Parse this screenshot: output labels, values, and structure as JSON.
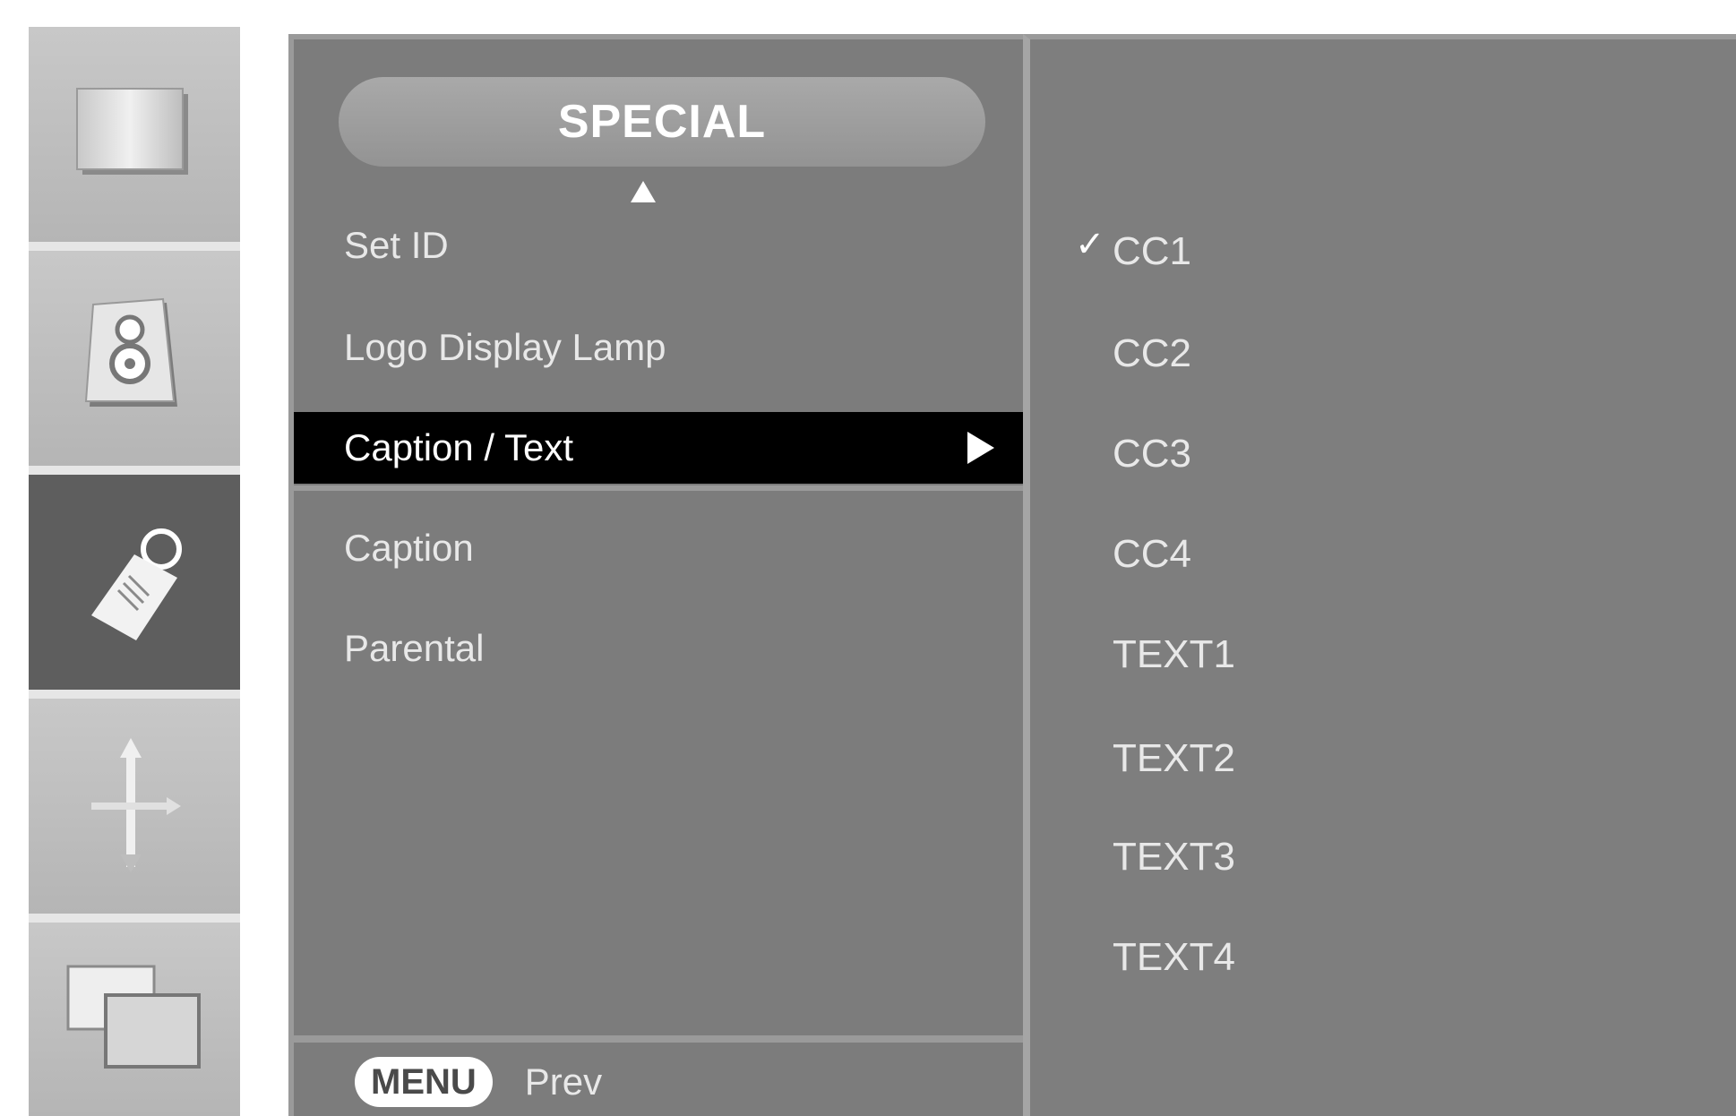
{
  "sidebar": {
    "items": [
      {
        "icon": "picture-icon",
        "active": false
      },
      {
        "icon": "speaker-icon",
        "active": false
      },
      {
        "icon": "special-tools-icon",
        "active": true
      },
      {
        "icon": "screen-position-icon",
        "active": false
      },
      {
        "icon": "pip-icon",
        "active": false
      }
    ]
  },
  "menu": {
    "title": "SPECIAL",
    "items": [
      {
        "label": "Set ID"
      },
      {
        "label": "Logo Display Lamp"
      },
      {
        "label": "Caption / Text",
        "selected": true
      },
      {
        "label": "Caption"
      },
      {
        "label": "Parental"
      }
    ]
  },
  "options": {
    "items": [
      {
        "label": "CC1",
        "checked": true
      },
      {
        "label": "CC2"
      },
      {
        "label": "CC3"
      },
      {
        "label": "CC4"
      },
      {
        "label": "TEXT1"
      },
      {
        "label": "TEXT2"
      },
      {
        "label": "TEXT3"
      },
      {
        "label": "TEXT4"
      }
    ]
  },
  "footer": {
    "menu_button": "MENU",
    "prev_label": "Prev"
  },
  "colors": {
    "panel": "#7c7c7c",
    "selected_row": "#000000",
    "active_tile": "#5e5e5e",
    "text": "#e8e8e8"
  }
}
